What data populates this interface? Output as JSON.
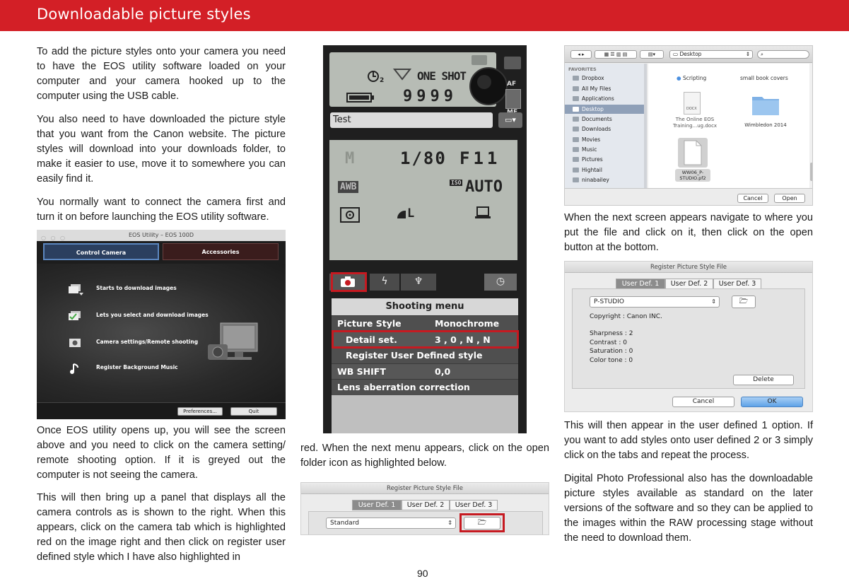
{
  "header": {
    "title": "Downloadable picture styles"
  },
  "paragraphs": {
    "p1": "To add the picture styles onto your camera you need to have the EOS utility software loaded on your computer and your camera hooked up to the computer using the USB cable.",
    "p2": "You also need to have downloaded the picture style that you want from the Canon website. The picture styles will download into your downloads folder, to make it easier to use, move it to somewhere you can easily find it.",
    "p3": "You normally want to connect the camera first and turn it on before launching the EOS utility software.",
    "p4": "Once EOS utility opens up, you will see the screen above and you need to click on the camera setting/ remote shooting option. If it is greyed out the computer is not seeing the camera.",
    "p5": "This will then bring up a panel that displays all the camera controls as is shown to the right. When this appears, click on the camera tab which is highlighted red  on the image right and then click on register user defined style which I have also highlighted in",
    "p6": "red. When the next menu appears, click on the open folder icon as highlighted below.",
    "p7": "When the next screen appears navigate to where you put the file and click on it, then click on the open button at the bottom.",
    "p8": "This will then appear in the user defined 1 option. If you want to add styles onto user defined 2 or 3 simply click on the tabs and repeat the process.",
    "p9": "Digital Photo Professional also has the downloadable picture styles available as standard on the later versions of the software and so they can be applied to the images within the RAW processing stage without the need to download them."
  },
  "page_number": "90",
  "eos_window": {
    "title": "EOS Utility – EOS 100D",
    "tabs": [
      "Control Camera",
      "Accessories"
    ],
    "items": [
      "Starts to download images",
      "Lets you select and download images",
      "Camera settings/Remote shooting",
      "Register Background Music"
    ],
    "buttons": {
      "preferences": "Preferences...",
      "quit": "Quit"
    }
  },
  "camera_panel": {
    "drive_mode": "ONE SHOT",
    "shots": "9999",
    "af_label": "AF",
    "mf_label": "MF",
    "name_field": "Test",
    "mode": "M",
    "shutter": "1/80",
    "aperture": "F11",
    "wb": "AWB",
    "iso_label": "ISO",
    "iso": "AUTO",
    "quality": "L",
    "menu": {
      "title": "Shooting menu",
      "rows": [
        {
          "label": "Picture Style",
          "value": "Monochrome"
        },
        {
          "label": "Detail set.",
          "value": "3 , 0 , N , N"
        },
        {
          "label": "Register User Defined style",
          "value": ""
        },
        {
          "label": "WB SHIFT",
          "value": "0,0"
        },
        {
          "label": "Lens aberration correction",
          "value": ""
        }
      ]
    }
  },
  "file_dialog": {
    "location": "Desktop",
    "favorites_header": "FAVORITES",
    "sidebar": [
      "Dropbox",
      "All My Files",
      "Applications",
      "Desktop",
      "Documents",
      "Downloads",
      "Movies",
      "Music",
      "Pictures",
      "Hightail",
      "ninabailey"
    ],
    "files": {
      "scripting": "Scripting",
      "covers": "small book covers",
      "docx_badge": "DOCX",
      "training": "The Online EOS Training...ug.docx",
      "wimbledon": "Wimbledon 2014",
      "pf2": "WW06_P-STUDIO.pf2"
    },
    "buttons": {
      "cancel": "Cancel",
      "open": "Open"
    }
  },
  "register_dialog_large": {
    "title": "Register Picture Style File",
    "tabs": [
      "User Def. 1",
      "User Def. 2",
      "User Def. 3"
    ],
    "style": "P-STUDIO",
    "copyright": "Copyright : Canon INC.",
    "params": [
      "Sharpness : 2",
      "Contrast : 0",
      "Saturation : 0",
      "Color tone : 0"
    ],
    "buttons": {
      "delete": "Delete",
      "cancel": "Cancel",
      "ok": "OK"
    }
  },
  "register_dialog_small": {
    "title": "Register Picture Style File",
    "tabs": [
      "User Def. 1",
      "User Def. 2",
      "User Def. 3"
    ],
    "style": "Standard"
  },
  "colors": {
    "brand_red": "#d31f26",
    "highlight_red": "#c61a21"
  }
}
